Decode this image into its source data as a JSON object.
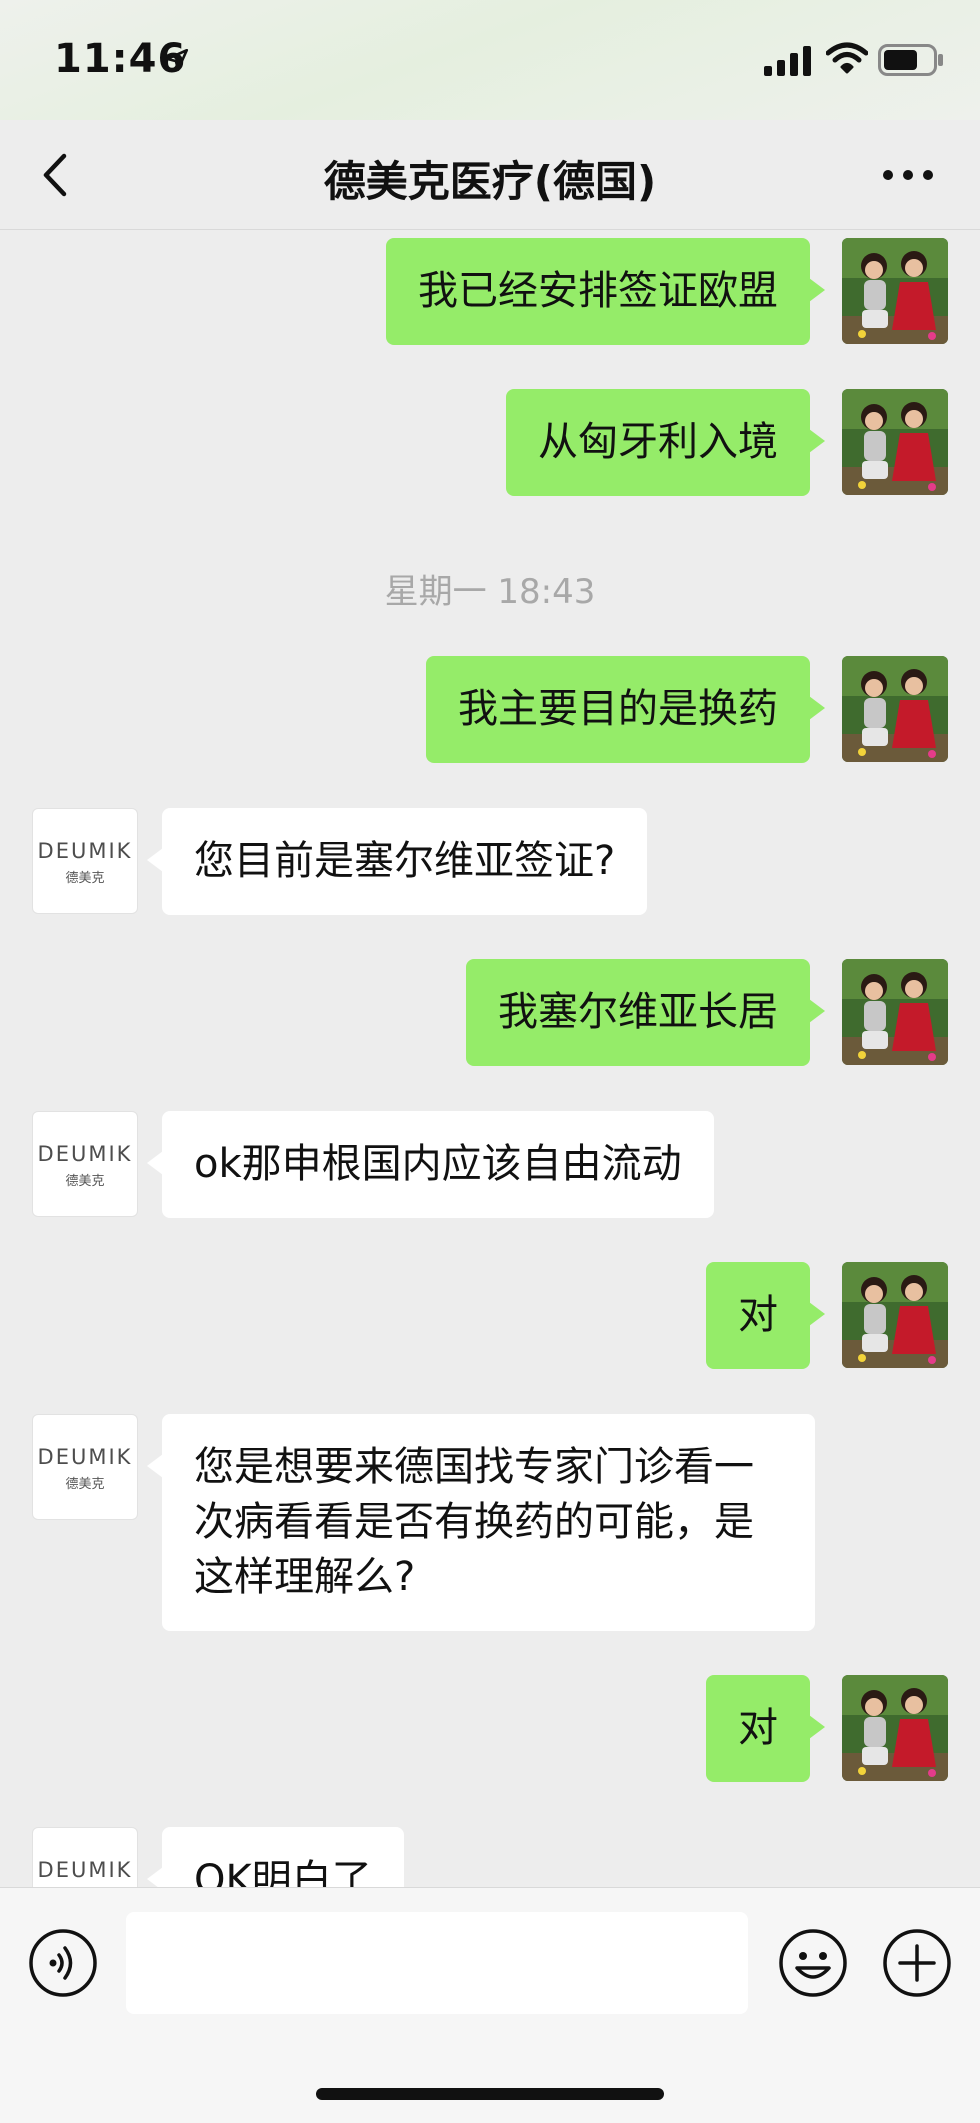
{
  "status_bar": {
    "time": "11:46",
    "location_icon": "location-arrow-icon",
    "signal_icon": "cellular-signal-icon",
    "wifi_icon": "wifi-icon",
    "battery_icon": "battery-icon",
    "battery_level": 0.7
  },
  "nav": {
    "back_icon": "chevron-left-icon",
    "title": "德美克医疗(德国)",
    "more_icon": "more-dots-icon"
  },
  "contact": {
    "logo_text": "DEUMIK",
    "logo_subtext": "德美克"
  },
  "messages": [
    {
      "sender": "self",
      "text": "我已经安排签证欧盟"
    },
    {
      "sender": "self",
      "text": "从匈牙利入境"
    },
    {
      "type": "time",
      "text": "星期一 18:43"
    },
    {
      "sender": "self",
      "text": "我主要目的是换药"
    },
    {
      "sender": "other",
      "text": "您目前是塞尔维亚签证?"
    },
    {
      "sender": "self",
      "text": "我塞尔维亚长居"
    },
    {
      "sender": "other",
      "text": "ok那申根国内应该自由流动"
    },
    {
      "sender": "self",
      "text": "对"
    },
    {
      "sender": "other",
      "text": "您是想要来德国找专家门诊看一次病看看是否有换药的可能，是这样理解么?"
    },
    {
      "sender": "self",
      "text": "对"
    },
    {
      "sender": "other",
      "text": "OK明白了"
    }
  ],
  "input_bar": {
    "voice_icon": "voice-icon",
    "text_value": "",
    "emoji_icon": "emoji-icon",
    "plus_icon": "plus-circle-icon"
  },
  "colors": {
    "self_bubble": "#95ec69",
    "other_bubble": "#ffffff",
    "background": "#ededed"
  }
}
